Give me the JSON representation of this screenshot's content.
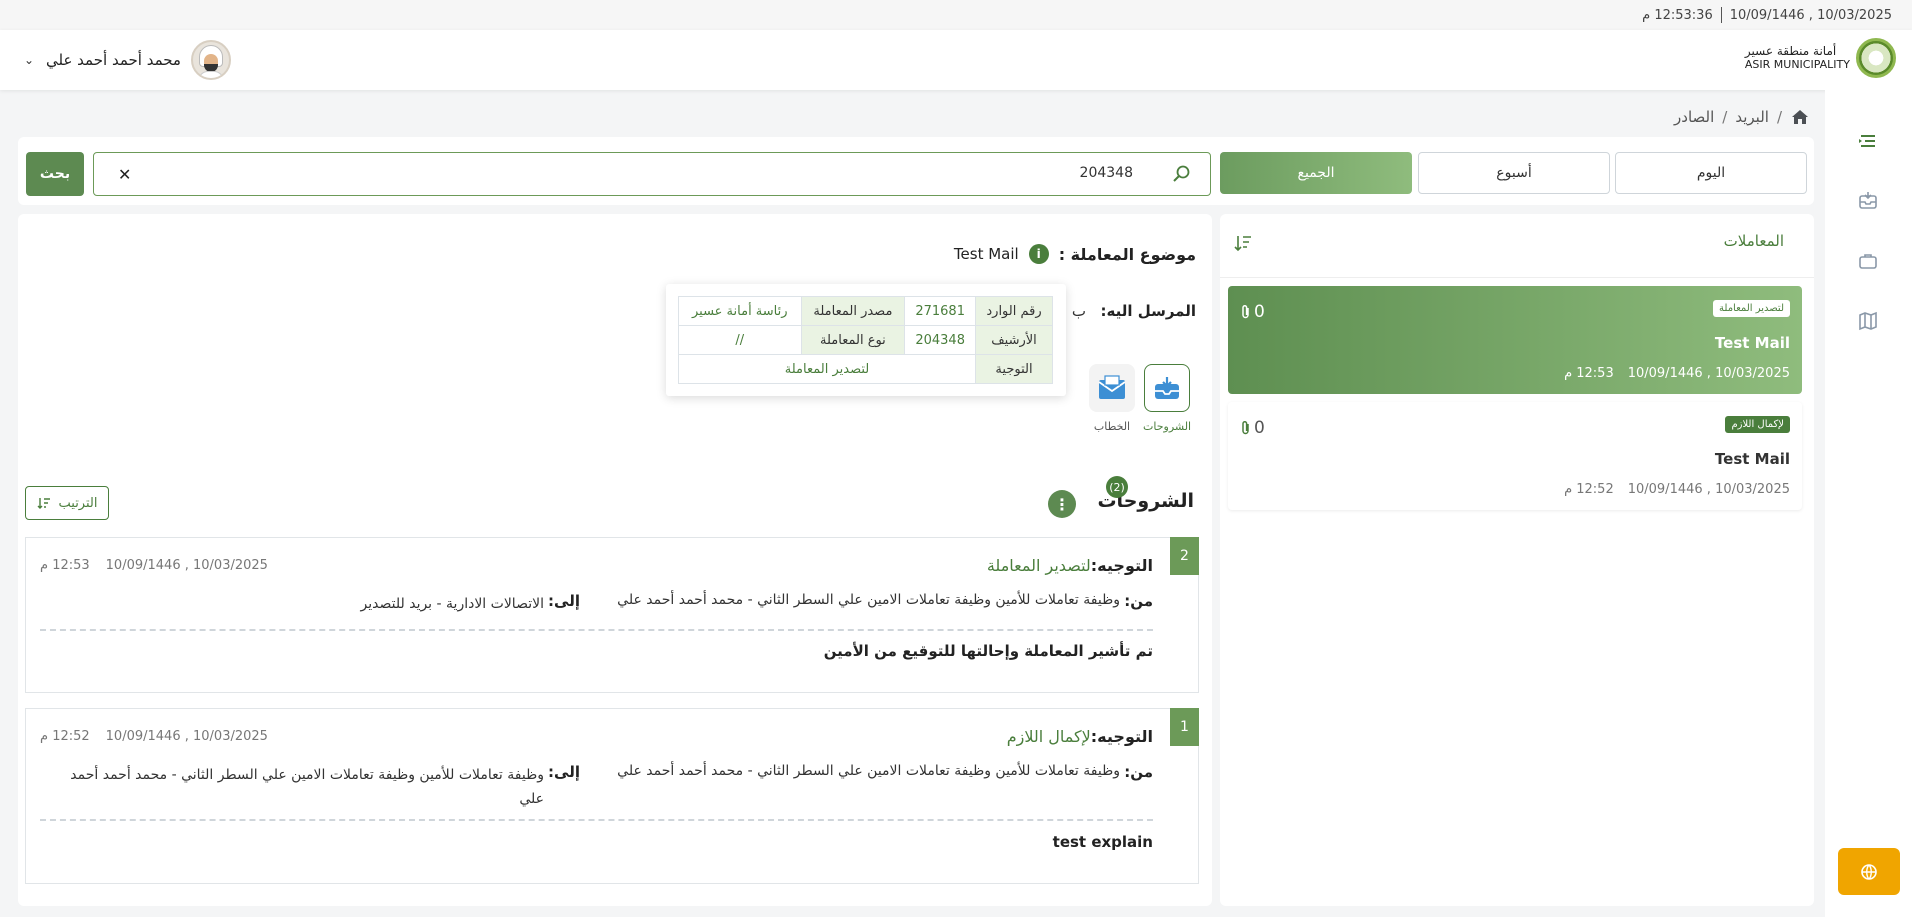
{
  "topbar": {
    "time": "12:53:36 م",
    "date": "10/03/2025 , 10/09/1446"
  },
  "header": {
    "org_name_ar": "أمانة منطقة عسير",
    "org_name_en": "ASIR MUNICIPALITY",
    "user_name": "محمد أحمد أحمد علي"
  },
  "breadcrumb": [
    "البريد",
    "الصادر"
  ],
  "filters": {
    "today": "اليوم",
    "week": "أسبوع",
    "all": "الجميع",
    "search_value": "204348",
    "search_button": "بحث"
  },
  "list": {
    "title": "المعاملات",
    "items": [
      {
        "tag": "لتصدير المعاملة",
        "subject": "Test Mail",
        "count": "0",
        "date": "10/03/2025 , 10/09/1446",
        "time": "12:53 م"
      },
      {
        "tag": "لإكمال اللازم",
        "subject": "Test Mail",
        "count": "0",
        "date": "10/03/2025 , 10/09/1446",
        "time": "12:52 م"
      }
    ]
  },
  "details": {
    "subject_label": "موضوع المعاملة :",
    "subject_value": "Test Mail",
    "recipient_label": "المرسل اليه:",
    "recipient_value": "ب",
    "popup": {
      "incoming_no_label": "رقم الوارد",
      "incoming_no": "271681",
      "source_label": "مصدر المعاملة",
      "source": "رئاسة أمانة عسير",
      "archive_label": "الأرشيف",
      "archive": "204348",
      "type_label": "نوع المعاملة",
      "type": "//",
      "routing_label": "التوجية",
      "routing": "لتصدير المعاملة"
    },
    "doc_buttons": {
      "sharhat": "الشروحات",
      "khitab": "الخطاب"
    },
    "sharhat_title": "الشروحات",
    "sharhat_count": "(2)",
    "order_button": "الترتيب",
    "entries": [
      {
        "num": "2",
        "dir_label": "التوجيه:",
        "dir_value": "لتصدير المعاملة",
        "date": "10/03/2025 , 10/09/1446",
        "time": "12:53 م",
        "from_label": "من:",
        "from_value": "وظيفة تعاملات للأمين وظيفة تعاملات الامين علي السطر الثاني - محمد أحمد أحمد علي",
        "to_label": "إلى:",
        "to_value": "الاتصالات الادارية - بريد للتصدير",
        "note": "تم تأشير المعاملة وإحالتها للتوقيع من الأمين"
      },
      {
        "num": "1",
        "dir_label": "التوجيه:",
        "dir_value": "لإكمال اللازم",
        "date": "10/03/2025 , 10/09/1446",
        "time": "12:52 م",
        "from_label": "من:",
        "from_value": "وظيفة تعاملات للأمين وظيفة تعاملات الامين علي السطر الثاني - محمد أحمد أحمد علي",
        "to_label": "إلى:",
        "to_value": "وظيفة تعاملات للأمين وظيفة تعاملات الامين علي السطر الثاني - محمد أحمد أحمد علي",
        "note": "test explain"
      }
    ]
  },
  "colors": {
    "brand_green": "#4a7e3c",
    "accent_orange": "#f0a500"
  },
  "icons": [
    "home-icon",
    "search-icon",
    "close-icon",
    "sort-icon",
    "paperclip-icon",
    "info-icon",
    "inbox-icon",
    "envelope-icon",
    "kebab-icon",
    "globe-icon",
    "chevron-down-icon",
    "menu-icon",
    "briefcase-icon",
    "map-icon"
  ]
}
